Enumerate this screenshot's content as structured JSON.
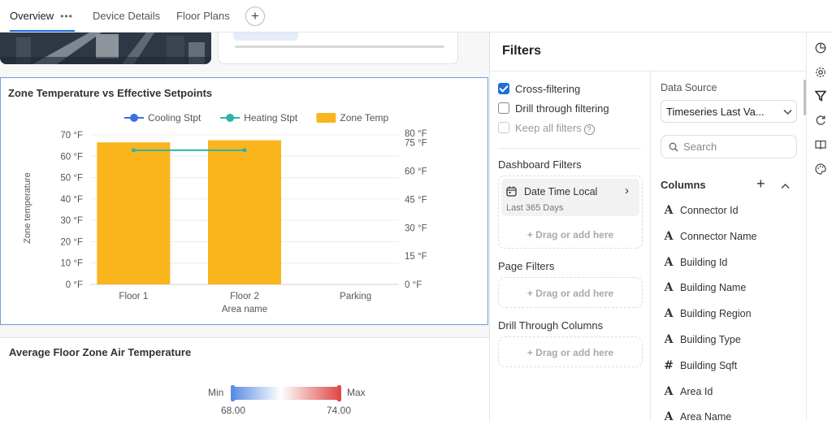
{
  "tabs": [
    {
      "label": "Overview",
      "more": "•••"
    },
    {
      "label": "Device Details"
    },
    {
      "label": "Floor Plans"
    }
  ],
  "add_tab_symbol": "+",
  "colors": {
    "accent": "#1e6fd9",
    "cooling": "#3b6fe0",
    "heating": "#2fb3a8",
    "zone_temp": "#fab51c"
  },
  "chart1": {
    "title": "Zone Temperature vs Effective Setpoints",
    "legend": [
      {
        "label": "Cooling Stpt",
        "type": "line",
        "color": "#3b6fe0"
      },
      {
        "label": "Heating Stpt",
        "type": "line",
        "color": "#2fb3a8"
      },
      {
        "label": "Zone Temp",
        "type": "bar",
        "color": "#fab51c"
      }
    ],
    "left_ticks": [
      "0 °F",
      "10 °F",
      "20 °F",
      "30 °F",
      "40 °F",
      "50 °F",
      "60 °F",
      "70 °F"
    ],
    "right_ticks": [
      "0 °F",
      "15 °F",
      "30 °F",
      "45 °F",
      "60 °F",
      "75 °F",
      "80 °F"
    ],
    "xlabel": "Area name",
    "ylabel": "Zone temperature"
  },
  "chart_data": {
    "type": "bar",
    "categories": [
      "Floor 1",
      "Floor 2",
      "Parking"
    ],
    "series": [
      {
        "name": "Zone Temp",
        "axis": "left",
        "values": [
          66.5,
          67.5,
          null
        ]
      },
      {
        "name": "Heating Stpt",
        "axis": "right",
        "values": [
          71,
          71,
          null
        ]
      }
    ],
    "ylim_left": [
      0,
      70
    ],
    "ylim_right": [
      0,
      80
    ],
    "grid": true,
    "legend_position": "top"
  },
  "chart2": {
    "title": "Average Floor Zone Air Temperature",
    "min_label": "Min",
    "max_label": "Max",
    "min_value": "68.00",
    "max_value": "74.00"
  },
  "filters": {
    "title": "Filters",
    "options": [
      {
        "label": "Cross-filtering",
        "checked": true
      },
      {
        "label": "Drill through filtering",
        "checked": false
      },
      {
        "label": "Keep all filters",
        "checked": false,
        "disabled": true
      }
    ],
    "dashboard_filters_label": "Dashboard Filters",
    "date_filter": {
      "name": "Date Time Local",
      "value": "Last 365 Days"
    },
    "drag_text": "+ Drag or add here",
    "page_filters_label": "Page Filters",
    "drill_columns_label": "Drill Through Columns",
    "data_source_label": "Data Source",
    "data_source_value": "Timeseries Last Va...",
    "search_placeholder": "Search",
    "columns_label": "Columns",
    "columns": [
      {
        "type": "A",
        "name": "Connector Id"
      },
      {
        "type": "A",
        "name": "Connector Name"
      },
      {
        "type": "A",
        "name": "Building Id"
      },
      {
        "type": "A",
        "name": "Building Name"
      },
      {
        "type": "A",
        "name": "Building Region"
      },
      {
        "type": "A",
        "name": "Building Type"
      },
      {
        "type": "#",
        "name": "Building Sqft"
      },
      {
        "type": "A",
        "name": "Area Id"
      },
      {
        "type": "A",
        "name": "Area Name"
      }
    ]
  },
  "rail_icons": [
    "chart-pie-icon",
    "gear-icon",
    "filter-icon",
    "refresh-icon",
    "book-icon",
    "palette-icon"
  ]
}
